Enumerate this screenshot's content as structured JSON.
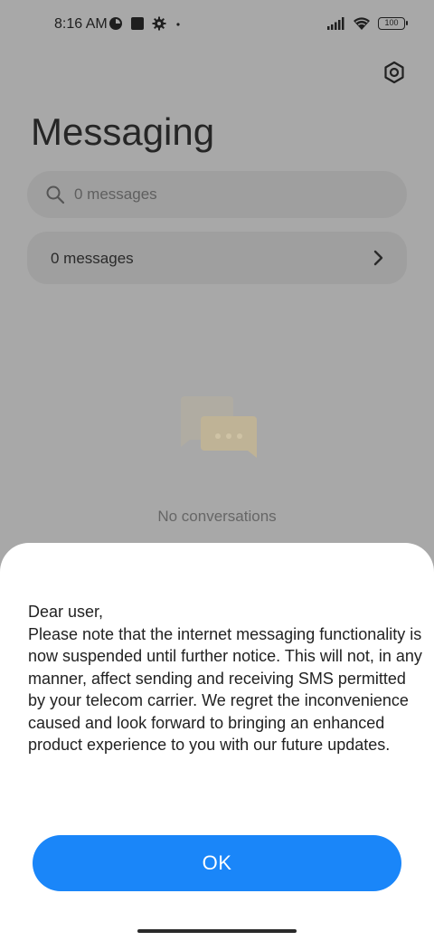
{
  "status_bar": {
    "time": "8:16 AM",
    "battery": "100",
    "left_icons": [
      "timer-icon",
      "square-icon",
      "gear-icon",
      "dot-icon"
    ],
    "right_icons": [
      "signal-icon",
      "wifi-icon",
      "battery-icon"
    ]
  },
  "header": {
    "title": "Messaging",
    "settings_icon": "settings-icon"
  },
  "search": {
    "placeholder": "0 messages",
    "icon": "search-icon"
  },
  "messages_row": {
    "label": "0 messages",
    "icon": "chevron-right-icon"
  },
  "empty_state": {
    "text": "No conversations",
    "icon": "chat-bubbles-icon"
  },
  "dialog": {
    "greeting": "Dear user,",
    "body": "Please note that the internet messaging functionality is now suspended until further notice. This will not, in any manner, affect sending and receiving SMS permitted by your telecom carrier. We regret the inconvenience caused and look forward to bringing an enhanced product experience to you with our future updates.",
    "ok_label": "OK"
  },
  "colors": {
    "accent": "#1a86f9",
    "scrim_background": "#a8a8a8",
    "sheet_background": "#ffffff",
    "illustration": "#e3cfa0"
  }
}
